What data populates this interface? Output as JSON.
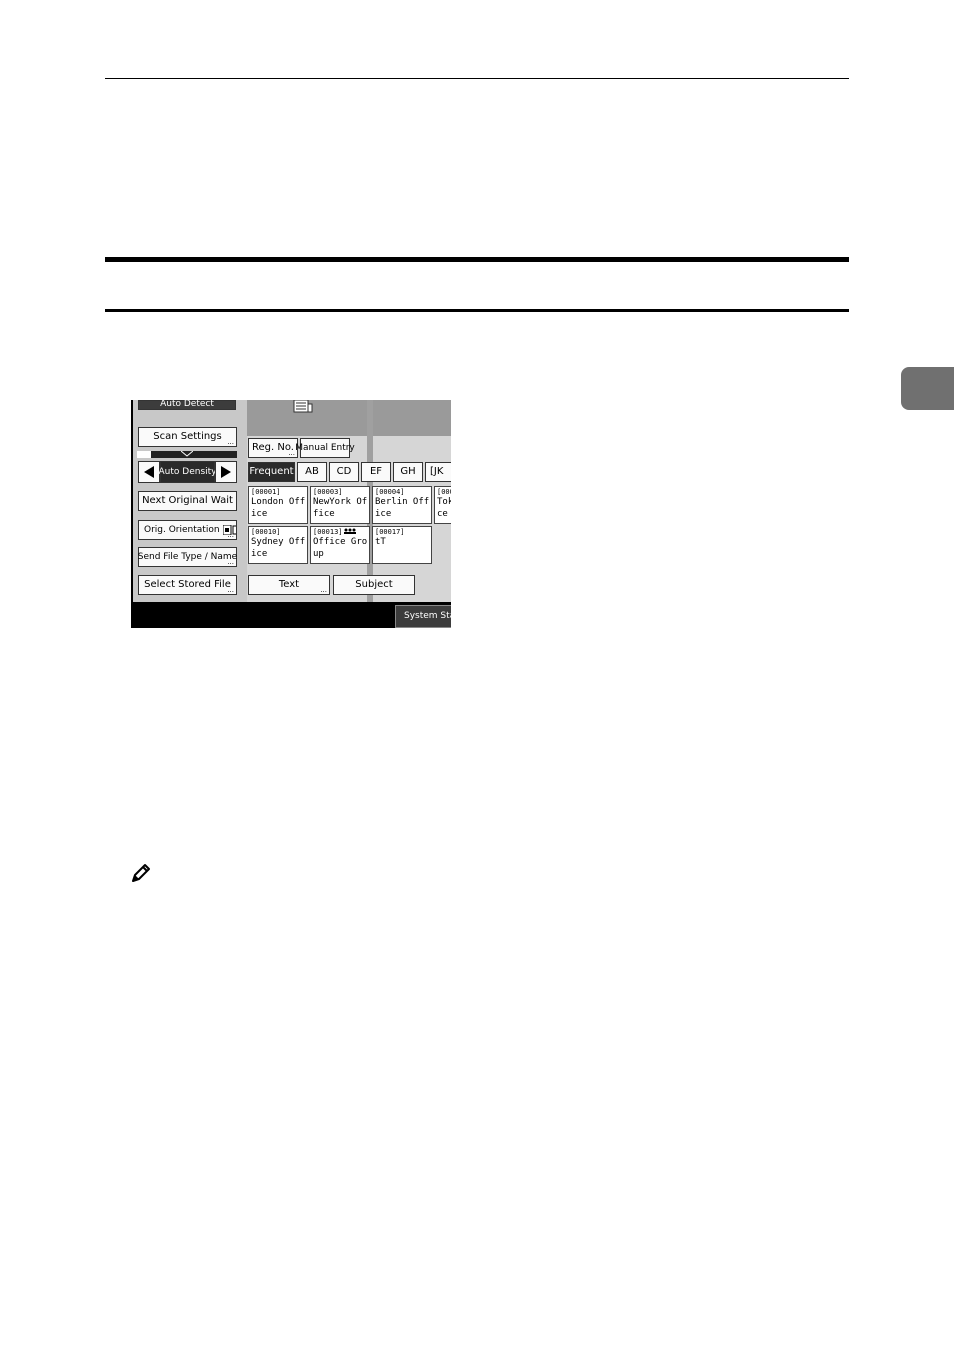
{
  "panel": {
    "left": {
      "auto_detect": "Auto Detect",
      "scan_settings": "Scan Settings",
      "auto_density": "Auto Density",
      "next_original_wait": "Next Original Wait",
      "orig_orientation": "Orig. Orientation",
      "send_file_type_name": "Send File Type / Name",
      "select_stored_file": "Select Stored File"
    },
    "right": {
      "reg_no": "Reg. No.",
      "manual_entry": "Manual Entry",
      "tabs": [
        "Frequent",
        "AB",
        "CD",
        "EF",
        "GH",
        "[JK"
      ],
      "destinations": [
        {
          "id": "[00001]",
          "line1": "London Off",
          "line2": "ice"
        },
        {
          "id": "[00003]",
          "line1": "NewYork Of",
          "line2": "fice"
        },
        {
          "id": "[00004]",
          "line1": "Berlin Off",
          "line2": "ice"
        },
        {
          "id": "[000",
          "line1": "Tok",
          "line2": "ce"
        },
        {
          "id": "[00010]",
          "line1": "Sydney Off",
          "line2": "ice"
        },
        {
          "id": "[00013]",
          "line1": "Office Gro",
          "line2": "up"
        },
        {
          "id": "[00017]",
          "line1": "tT",
          "line2": ""
        }
      ],
      "text_button": "Text",
      "subject_button": "Subject",
      "system_status": "System Status"
    }
  }
}
